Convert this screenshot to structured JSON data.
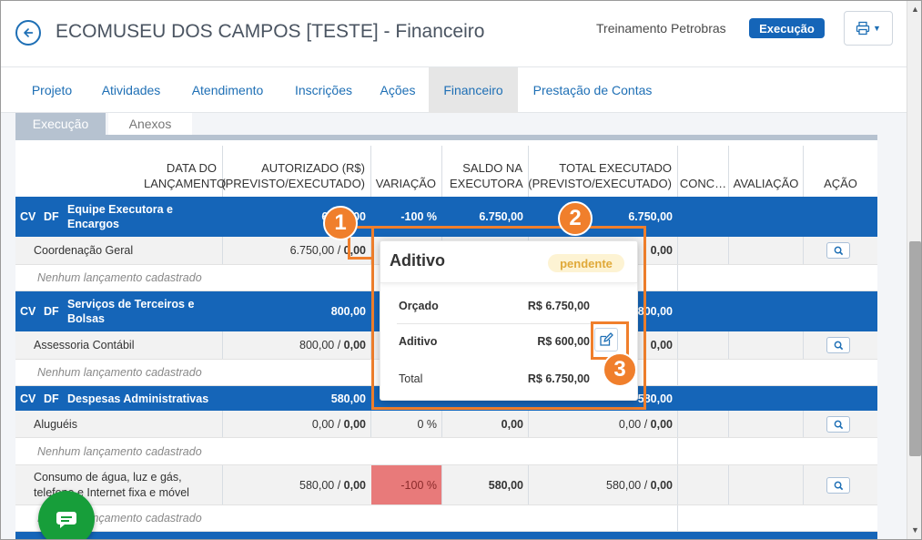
{
  "header": {
    "title": "ECOMUSEU DOS CAMPOS [TESTE] - Financeiro",
    "training": "Treinamento Petrobras",
    "status": "Execução"
  },
  "nav": {
    "tabs": [
      "Projeto",
      "Atividades",
      "Atendimento",
      "Inscrições",
      "Ações",
      "Financeiro",
      "Prestação de Contas"
    ],
    "active": "Financeiro"
  },
  "subtabs": [
    "Execução",
    "Anexos"
  ],
  "table": {
    "headers": {
      "data": "DATA DO LANÇAMENTO",
      "autorizado": "AUTORIZADO (R$) (PREVISTO/EXECUTADO)",
      "variacao": "VARIAÇÃO",
      "saldo": "SALDO NA EXECUTORA",
      "total": "TOTAL EXECUTADO (PREVISTO/EXECUTADO)",
      "conc": "CONC…",
      "avaliacao": "AVALIAÇÃO",
      "acao": "AÇÃO"
    },
    "categories": [
      {
        "cv": "CV",
        "df": "DF",
        "name": "Equipe Executora e Encargos",
        "autorizado": "6.750,00",
        "variacao": "-100 %",
        "saldo": "6.750,00",
        "total": "6.750,00"
      },
      {
        "cv": "CV",
        "df": "DF",
        "name": "Serviços de Terceiros e Bolsas",
        "autorizado": "800,00",
        "total": "800,00"
      },
      {
        "cv": "CV",
        "df": "DF",
        "name": "Despesas Administrativas",
        "autorizado": "580,00",
        "total": "580,00"
      }
    ],
    "items": [
      {
        "name": "Coordenação Geral",
        "prev": "6.750,00",
        "exec": "0,00",
        "total_prev": "0,00"
      },
      {
        "name": "Assessoria Contábil",
        "prev": "800,00",
        "exec": "0,00",
        "total_prev": "0,00"
      },
      {
        "name": "Aluguéis",
        "prev": "0,00",
        "exec": "0,00",
        "variacao": "0 %",
        "saldo": "0,00",
        "total_prev": "0,00",
        "total_exec": "0,00"
      },
      {
        "name_line1": "Consumo de água, luz e gás,",
        "name_line2": "telefone e Internet fixa e móvel",
        "prev": "580,00",
        "exec": "0,00",
        "variacao": "-100 %",
        "saldo": "580,00",
        "total_prev": "580,00",
        "total_exec": "0,00"
      }
    ],
    "empty": "Nenhum lançamento cadastrado"
  },
  "popup": {
    "title": "Aditivo",
    "status": "pendente",
    "rows": [
      {
        "label": "Orçado",
        "value": "R$ 6.750,00"
      },
      {
        "label": "Aditivo",
        "value": "R$ 600,00"
      },
      {
        "label": "Total",
        "value": "R$ 6.750,00"
      }
    ]
  },
  "markers": [
    "1",
    "2",
    "3"
  ],
  "icons": {
    "back": "arrow-left-icon",
    "print": "printer-icon",
    "search": "search-icon",
    "edit": "edit-icon",
    "chat": "chat-icon"
  },
  "colors": {
    "primary": "#1565b8",
    "annotation": "#f07f2c",
    "negative": "#e87a7a",
    "pending_bg": "#fdf3d3",
    "chat": "#179e3a"
  }
}
